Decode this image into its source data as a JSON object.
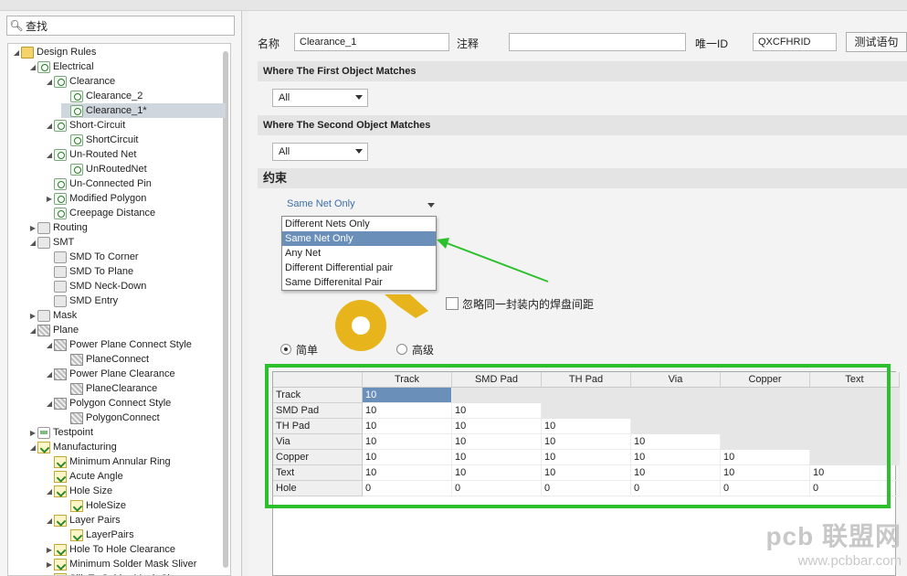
{
  "search": {
    "label": "查找"
  },
  "tree": [
    {
      "label": "Design Rules",
      "level": 0,
      "exp": "open",
      "icon": "folder"
    },
    {
      "label": "Electrical",
      "level": 1,
      "exp": "open",
      "icon": "rule"
    },
    {
      "label": "Clearance",
      "level": 2,
      "exp": "open",
      "icon": "rule"
    },
    {
      "label": "Clearance_2",
      "level": 3,
      "exp": "",
      "icon": "rule"
    },
    {
      "label": "Clearance_1*",
      "level": 3,
      "exp": "",
      "icon": "rule",
      "selected": true
    },
    {
      "label": "Short-Circuit",
      "level": 2,
      "exp": "open",
      "icon": "rule"
    },
    {
      "label": "ShortCircuit",
      "level": 3,
      "exp": "",
      "icon": "rule"
    },
    {
      "label": "Un-Routed Net",
      "level": 2,
      "exp": "open",
      "icon": "rule"
    },
    {
      "label": "UnRoutedNet",
      "level": 3,
      "exp": "",
      "icon": "rule"
    },
    {
      "label": "Un-Connected Pin",
      "level": 2,
      "exp": "",
      "icon": "rule"
    },
    {
      "label": "Modified Polygon",
      "level": 2,
      "exp": "closed",
      "icon": "rule"
    },
    {
      "label": "Creepage Distance",
      "level": 2,
      "exp": "",
      "icon": "rule"
    },
    {
      "label": "Routing",
      "level": 1,
      "exp": "closed",
      "icon": "grey"
    },
    {
      "label": "SMT",
      "level": 1,
      "exp": "open",
      "icon": "grey"
    },
    {
      "label": "SMD To Corner",
      "level": 2,
      "exp": "",
      "icon": "grey"
    },
    {
      "label": "SMD To Plane",
      "level": 2,
      "exp": "",
      "icon": "grey"
    },
    {
      "label": "SMD Neck-Down",
      "level": 2,
      "exp": "",
      "icon": "grey"
    },
    {
      "label": "SMD Entry",
      "level": 2,
      "exp": "",
      "icon": "grey"
    },
    {
      "label": "Mask",
      "level": 1,
      "exp": "closed",
      "icon": "grey"
    },
    {
      "label": "Plane",
      "level": 1,
      "exp": "open",
      "icon": "chk"
    },
    {
      "label": "Power Plane Connect Style",
      "level": 2,
      "exp": "open",
      "icon": "chk"
    },
    {
      "label": "PlaneConnect",
      "level": 3,
      "exp": "",
      "icon": "chk"
    },
    {
      "label": "Power Plane Clearance",
      "level": 2,
      "exp": "open",
      "icon": "chk"
    },
    {
      "label": "PlaneClearance",
      "level": 3,
      "exp": "",
      "icon": "chk"
    },
    {
      "label": "Polygon Connect Style",
      "level": 2,
      "exp": "open",
      "icon": "chk"
    },
    {
      "label": "PolygonConnect",
      "level": 3,
      "exp": "",
      "icon": "chk"
    },
    {
      "label": "Testpoint",
      "level": 1,
      "exp": "closed",
      "icon": "rule2"
    },
    {
      "label": "Manufacturing",
      "level": 1,
      "exp": "open",
      "icon": "yellow"
    },
    {
      "label": "Minimum Annular Ring",
      "level": 2,
      "exp": "",
      "icon": "yellow"
    },
    {
      "label": "Acute Angle",
      "level": 2,
      "exp": "",
      "icon": "yellow"
    },
    {
      "label": "Hole Size",
      "level": 2,
      "exp": "open",
      "icon": "yellow"
    },
    {
      "label": "HoleSize",
      "level": 3,
      "exp": "",
      "icon": "yellow"
    },
    {
      "label": "Layer Pairs",
      "level": 2,
      "exp": "open",
      "icon": "yellow"
    },
    {
      "label": "LayerPairs",
      "level": 3,
      "exp": "",
      "icon": "yellow"
    },
    {
      "label": "Hole To Hole Clearance",
      "level": 2,
      "exp": "closed",
      "icon": "yellow"
    },
    {
      "label": "Minimum Solder Mask Sliver",
      "level": 2,
      "exp": "closed",
      "icon": "yellow"
    },
    {
      "label": "Silk To Solder Mask Clearance",
      "level": 2,
      "exp": "closed",
      "icon": "yellow"
    }
  ],
  "form": {
    "name_label": "名称",
    "name_value": "Clearance_1",
    "comment_label": "注释",
    "comment_value": "",
    "uid_label": "唯一ID",
    "uid_value": "QXCFHRID",
    "test_button": "测试语句"
  },
  "first_match": {
    "title": "Where The First Object Matches",
    "select": "All"
  },
  "second_match": {
    "title": "Where The Second Object Matches",
    "select": "All"
  },
  "constraints": {
    "title": "约束",
    "net_scope_selected": "Same Net Only",
    "net_scope_options": [
      "Different Nets Only",
      "Same Net Only",
      "Any Net",
      "Different Differential pair",
      "Same Differenital Pair"
    ],
    "ignore_pads_label": "忽略同一封装内的焊盘间距",
    "simple_label": "简单",
    "advanced_label": "高级"
  },
  "matrix": {
    "columns": [
      "Track",
      "SMD Pad",
      "TH Pad",
      "Via",
      "Copper",
      "Text"
    ],
    "rows": [
      {
        "name": "Track",
        "values": [
          "10"
        ]
      },
      {
        "name": "SMD Pad",
        "values": [
          "10",
          "10"
        ]
      },
      {
        "name": "TH Pad",
        "values": [
          "10",
          "10",
          "10"
        ]
      },
      {
        "name": "Via",
        "values": [
          "10",
          "10",
          "10",
          "10"
        ]
      },
      {
        "name": "Copper",
        "values": [
          "10",
          "10",
          "10",
          "10",
          "10"
        ]
      },
      {
        "name": "Text",
        "values": [
          "10",
          "10",
          "10",
          "10",
          "10",
          "10"
        ]
      },
      {
        "name": "Hole",
        "values": [
          "0",
          "0",
          "0",
          "0",
          "0",
          "0"
        ]
      }
    ]
  },
  "watermark": {
    "brand": "pcb 联盟网",
    "url": "www.pcbbar.com"
  },
  "colors": {
    "highlight": "#2cc02c",
    "selection": "#6a8fb8",
    "pad": "#e8b41c"
  }
}
